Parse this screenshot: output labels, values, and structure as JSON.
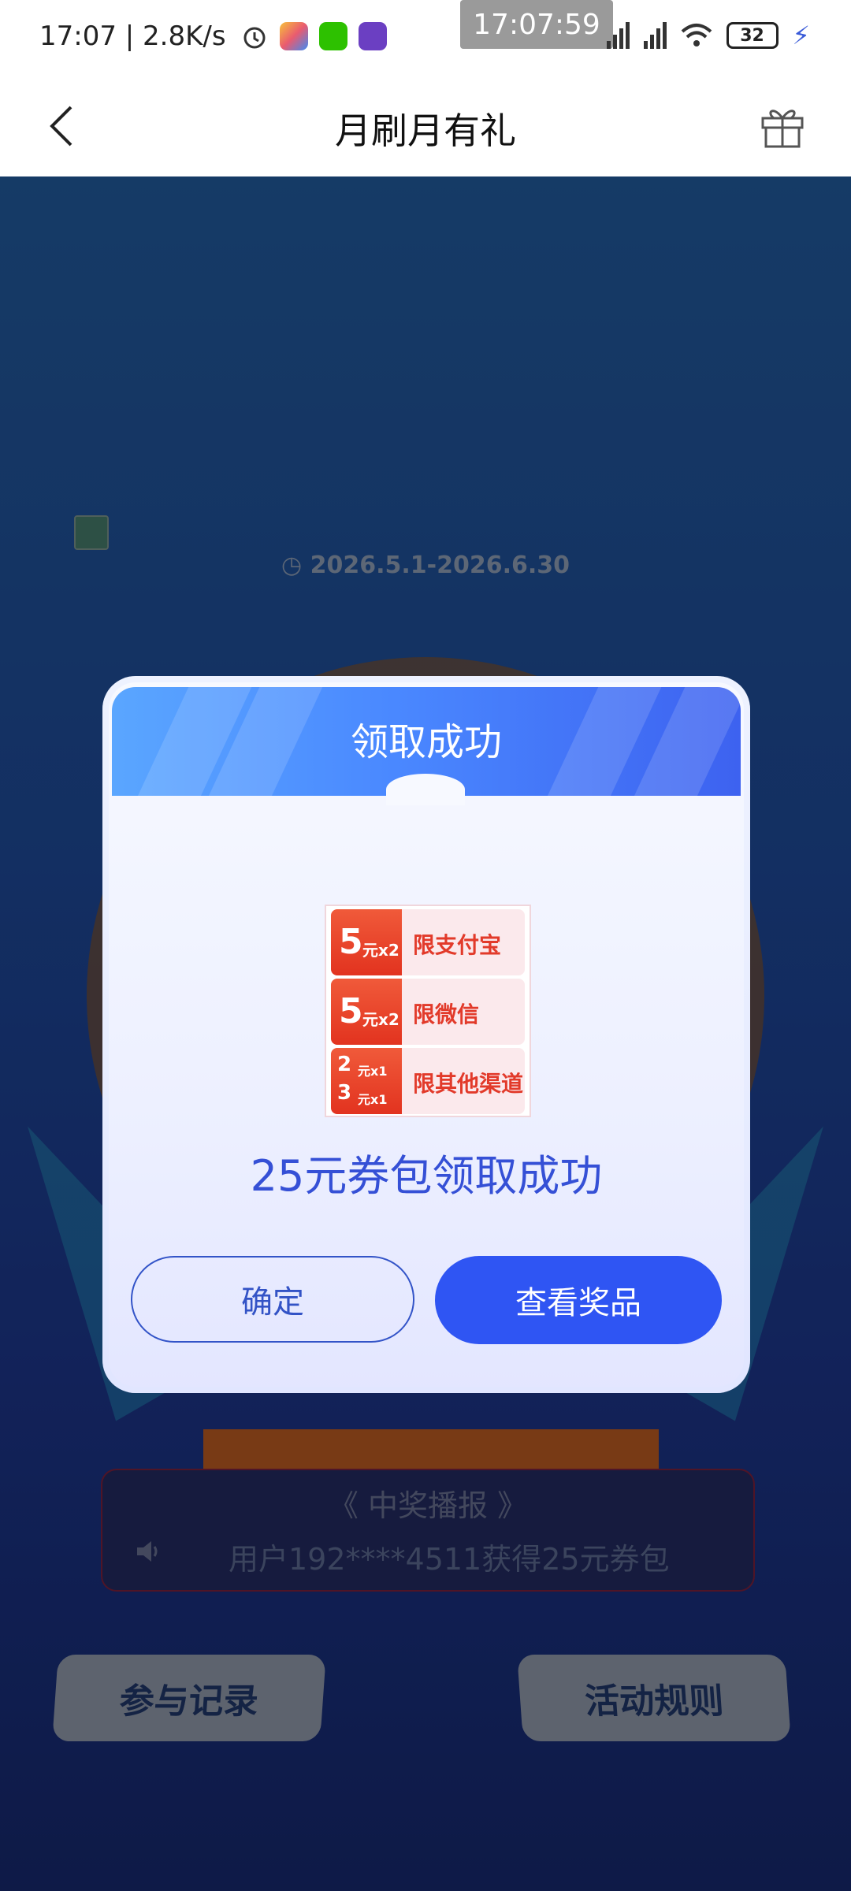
{
  "status_bar": {
    "time_speed": "17:07 | 2.8K/s",
    "clock_overlay": "17:07:59",
    "battery": "32"
  },
  "nav": {
    "title": "月刷月有礼"
  },
  "page": {
    "date_range": "2026.5.1-2026.6.30",
    "broadcast_title": "《 中奖播报 》",
    "broadcast_text": "用户192****4511获得25元券包",
    "record_button": "参与记录",
    "rules_button": "活动规则"
  },
  "dialog": {
    "title": "领取成功",
    "coupons": [
      {
        "amount": "5",
        "unit": "元x2",
        "label": "限支付宝"
      },
      {
        "amount": "5",
        "unit": "元x2",
        "label": "限微信"
      },
      {
        "amount_a": "2",
        "unit_a": "元x1",
        "amount_b": "3",
        "unit_b": "元x1",
        "label": "限其他渠道"
      }
    ],
    "message": "25元券包领取成功",
    "confirm_button": "确定",
    "view_button": "查看奖品"
  },
  "colors": {
    "primary_blue": "#2f55f3",
    "coupon_red": "#e2331f"
  }
}
